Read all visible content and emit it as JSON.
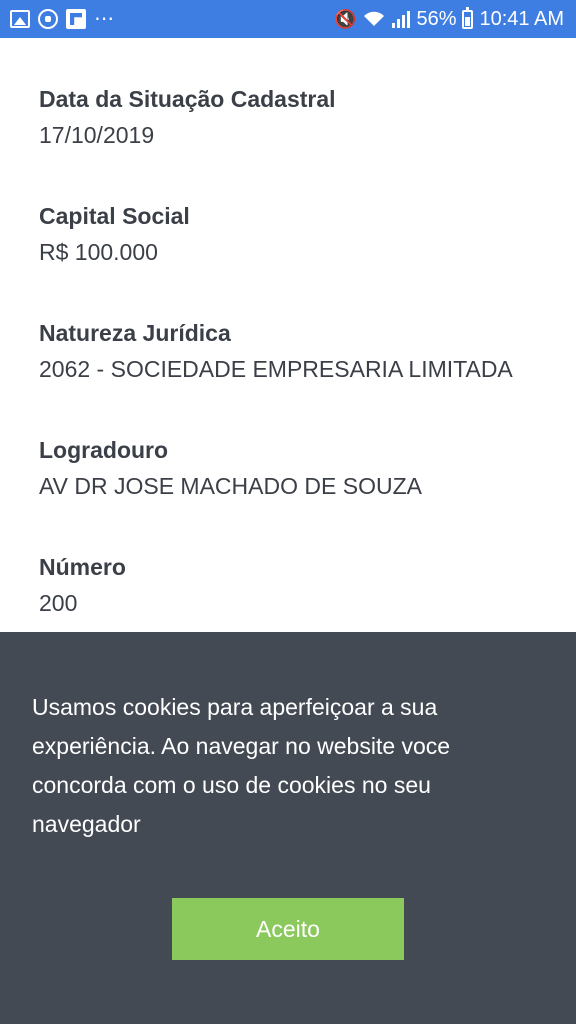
{
  "status_bar": {
    "battery": "56%",
    "time": "10:41 AM",
    "dots": "⋯",
    "icons_left": [
      "gallery-icon",
      "whatsapp-icon",
      "flipboard-icon",
      "more-dots-icon"
    ],
    "icons_right": [
      "mute-icon",
      "wifi-icon",
      "signal-icon",
      "battery-icon"
    ],
    "background": "#3e7ee3"
  },
  "fields": [
    {
      "label": "Data da Situação Cadastral",
      "value": "17/10/2019"
    },
    {
      "label": "Capital Social",
      "value": "R$ 100.000"
    },
    {
      "label": "Natureza Jurídica",
      "value": "2062 - SOCIEDADE EMPRESARIA LIMITADA"
    },
    {
      "label": "Logradouro",
      "value": "AV DR JOSE MACHADO DE SOUZA"
    },
    {
      "label": "Número",
      "value": "200"
    }
  ],
  "cookie_banner": {
    "text": "Usamos cookies para aperfeiçoar a sua experiência. Ao navegar no website voce concorda com o uso de cookies no seu navegador",
    "button_label": "Aceito",
    "background": "#434a54",
    "button_color": "#8cc95d"
  }
}
